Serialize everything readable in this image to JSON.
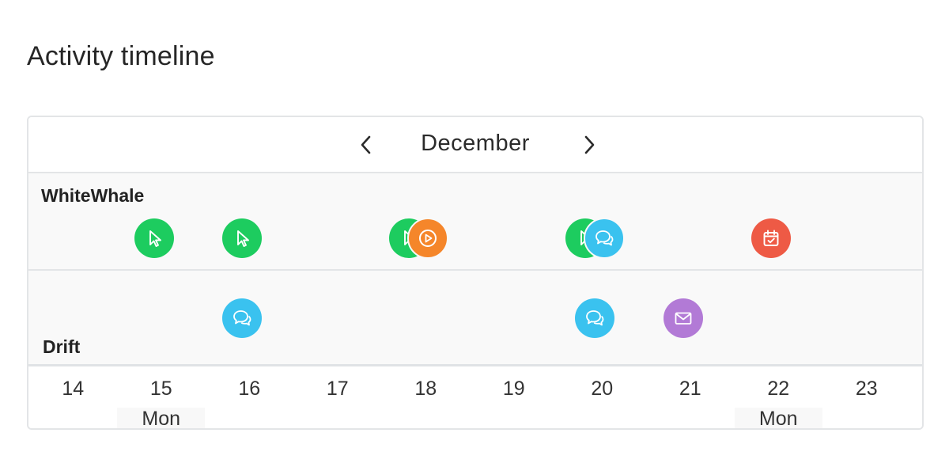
{
  "page": {
    "title": "Activity timeline"
  },
  "nav": {
    "month": "December",
    "prev_icon": "chevron-left-icon",
    "next_icon": "chevron-right-icon"
  },
  "rows": [
    {
      "label": "WhiteWhale"
    },
    {
      "label": "Drift"
    }
  ],
  "axis": {
    "days": [
      "14",
      "15",
      "16",
      "17",
      "18",
      "19",
      "20",
      "21",
      "22",
      "23"
    ],
    "weekday_labels": [
      {
        "day": "15",
        "label": "Mon"
      },
      {
        "day": "22",
        "label": "Mon"
      }
    ]
  },
  "colors": {
    "click": "#1dcc5f",
    "video": "#f5862a",
    "chat": "#3ac2ef",
    "email": "#b27ad6",
    "meeting": "#ee5a45",
    "border": "#e3e5e7",
    "row_bg": "#f9f9f9"
  },
  "events": [
    {
      "row": "WhiteWhale",
      "day": "15",
      "type": "click",
      "icon": "cursor-icon"
    },
    {
      "row": "WhiteWhale",
      "day": "16",
      "type": "click",
      "icon": "cursor-icon"
    },
    {
      "row": "WhiteWhale",
      "day": "18",
      "type": "click",
      "icon": "cursor-icon"
    },
    {
      "row": "WhiteWhale",
      "day": "18",
      "type": "video",
      "icon": "play-icon"
    },
    {
      "row": "WhiteWhale",
      "day": "20",
      "type": "click",
      "icon": "cursor-icon"
    },
    {
      "row": "WhiteWhale",
      "day": "20",
      "type": "chat",
      "icon": "chat-bubbles-icon"
    },
    {
      "row": "WhiteWhale",
      "day": "22",
      "type": "meeting",
      "icon": "calendar-check-icon"
    },
    {
      "row": "Drift",
      "day": "16",
      "type": "chat",
      "icon": "chat-bubbles-icon"
    },
    {
      "row": "Drift",
      "day": "20",
      "type": "chat",
      "icon": "chat-bubbles-icon"
    },
    {
      "row": "Drift",
      "day": "21",
      "type": "email",
      "icon": "envelope-icon"
    }
  ]
}
